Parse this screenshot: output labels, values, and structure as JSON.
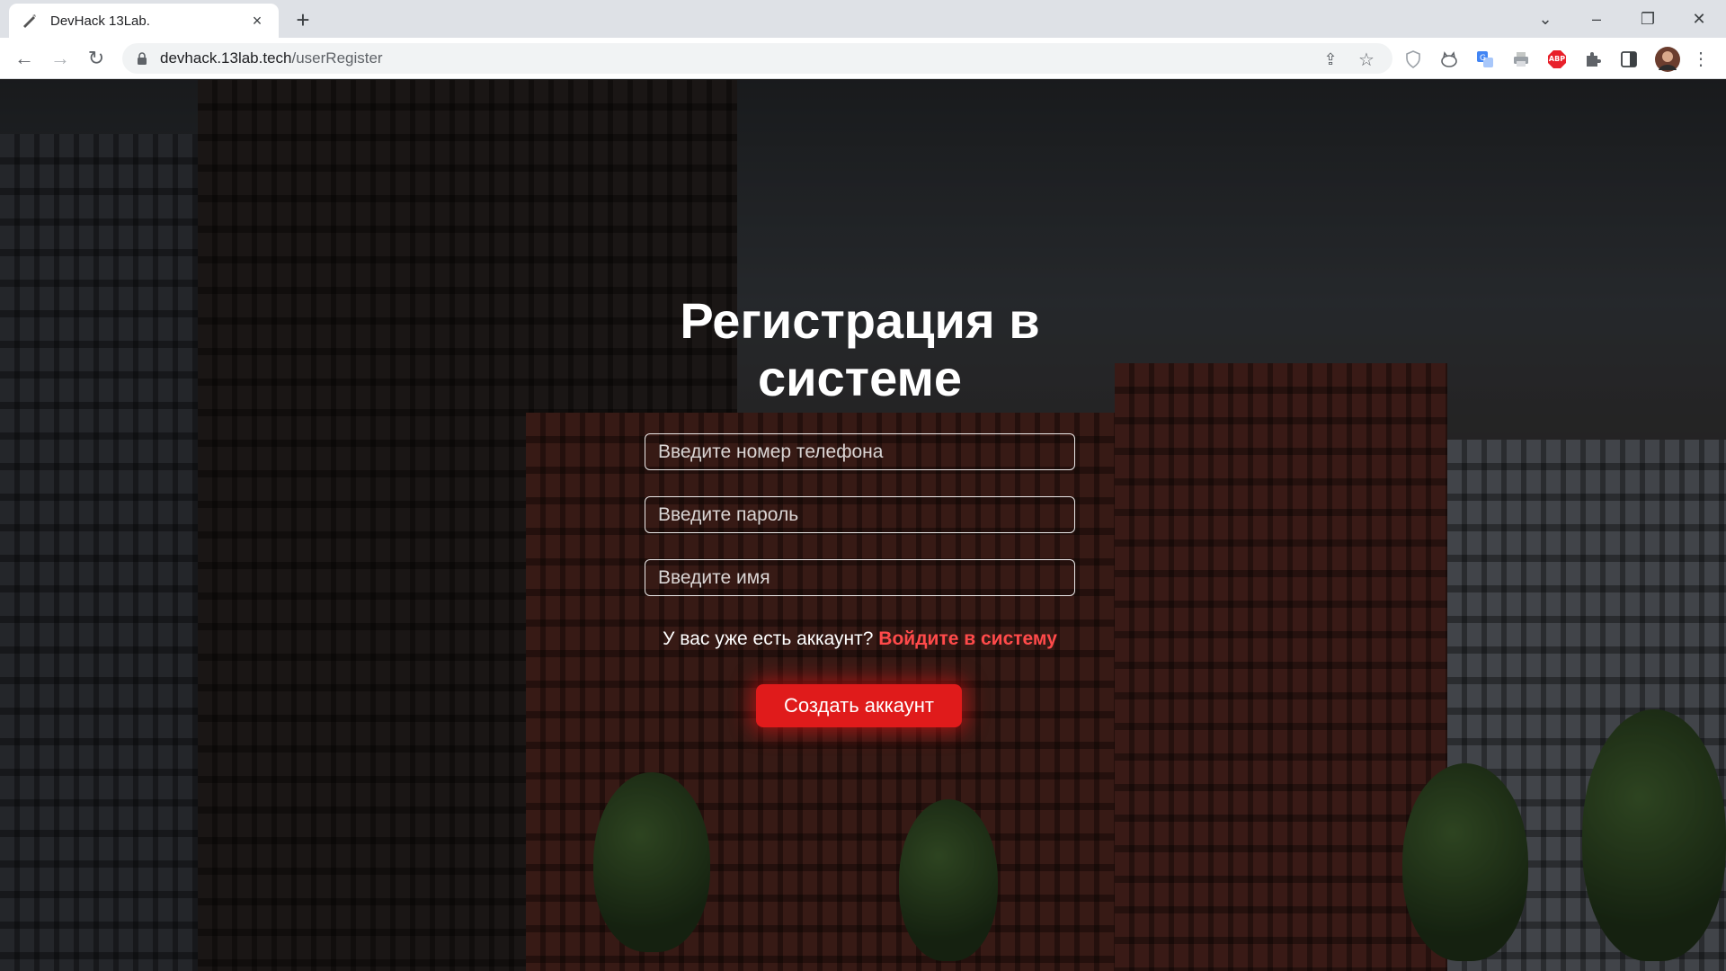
{
  "browser": {
    "tab_title": "DevHack 13Lab.",
    "url_host": "devhack.13lab.tech",
    "url_path": "/userRegister",
    "icons": {
      "tab_close": "×",
      "new_tab": "+",
      "tab_search": "⌄",
      "minimize": "–",
      "restore": "❐",
      "close": "✕",
      "back": "←",
      "forward": "→",
      "reload": "↻",
      "share": "⇪",
      "star": "☆",
      "menu": "⋮"
    },
    "extensions": [
      "shield-extension",
      "cat-extension",
      "translate-extension",
      "printer-extension",
      "adblock-plus-extension",
      "puzzle-extension",
      "sidepanel-extension",
      "profile-avatar"
    ],
    "adblock_label": "ABP"
  },
  "register": {
    "title": "Регистрация в системе",
    "phone_placeholder": "Введите номер телефона",
    "password_placeholder": "Введите пароль",
    "name_placeholder": "Введите имя",
    "have_account_text": "У вас уже есть аккаунт?",
    "login_link": "Войдите в систему",
    "create_button": "Создать аккаунт"
  },
  "colors": {
    "accent_red": "#e01b1b",
    "link_red": "#ff4a4a"
  }
}
